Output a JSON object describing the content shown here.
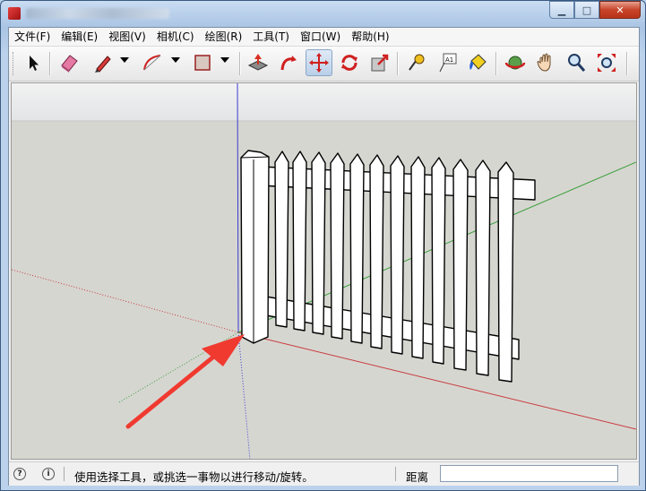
{
  "window": {
    "title": "",
    "minimize": "▁",
    "maximize": "□",
    "close": "✕"
  },
  "menu": [
    "文件(F)",
    "编辑(E)",
    "视图(V)",
    "相机(C)",
    "绘图(R)",
    "工具(T)",
    "窗口(W)",
    "帮助(H)"
  ],
  "toolbar": {
    "buttons": [
      {
        "name": "select-tool",
        "icon": "arrow-cursor-icon"
      },
      {
        "name": "eraser-tool",
        "icon": "eraser-icon"
      },
      {
        "name": "pencil-tool",
        "icon": "pencil-icon"
      },
      {
        "name": "arc-tool",
        "icon": "arc-icon"
      },
      {
        "name": "rectangle-tool",
        "icon": "rectangle-icon"
      },
      {
        "name": "push-pull-tool",
        "icon": "push-pull-icon"
      },
      {
        "name": "follow-me-tool",
        "icon": "follow-me-icon"
      },
      {
        "name": "move-tool",
        "icon": "move-icon",
        "active": true
      },
      {
        "name": "rotate-tool",
        "icon": "rotate-icon"
      },
      {
        "name": "scale-tool",
        "icon": "scale-icon"
      },
      {
        "name": "tape-measure-tool",
        "icon": "tape-measure-icon"
      },
      {
        "name": "text-tool",
        "icon": "text-label-icon",
        "label": "A1"
      },
      {
        "name": "paint-bucket-tool",
        "icon": "paint-bucket-icon"
      },
      {
        "name": "orbit-tool",
        "icon": "orbit-icon"
      },
      {
        "name": "pan-tool",
        "icon": "hand-icon"
      },
      {
        "name": "zoom-tool",
        "icon": "magnifier-icon"
      },
      {
        "name": "zoom-extents-tool",
        "icon": "zoom-extents-icon"
      }
    ]
  },
  "status": {
    "message": "使用选择工具，或挑选一事物以进行移动/旋转。",
    "measure_label": "距离",
    "measure_value": ""
  },
  "colors": {
    "viewport_bg": "#d6d6d1",
    "sky": "#e9eaea",
    "axis_red": "#c83c3c",
    "axis_green": "#3aa03a",
    "axis_blue": "#3a3ad0",
    "annotation_arrow": "#f03a30"
  }
}
